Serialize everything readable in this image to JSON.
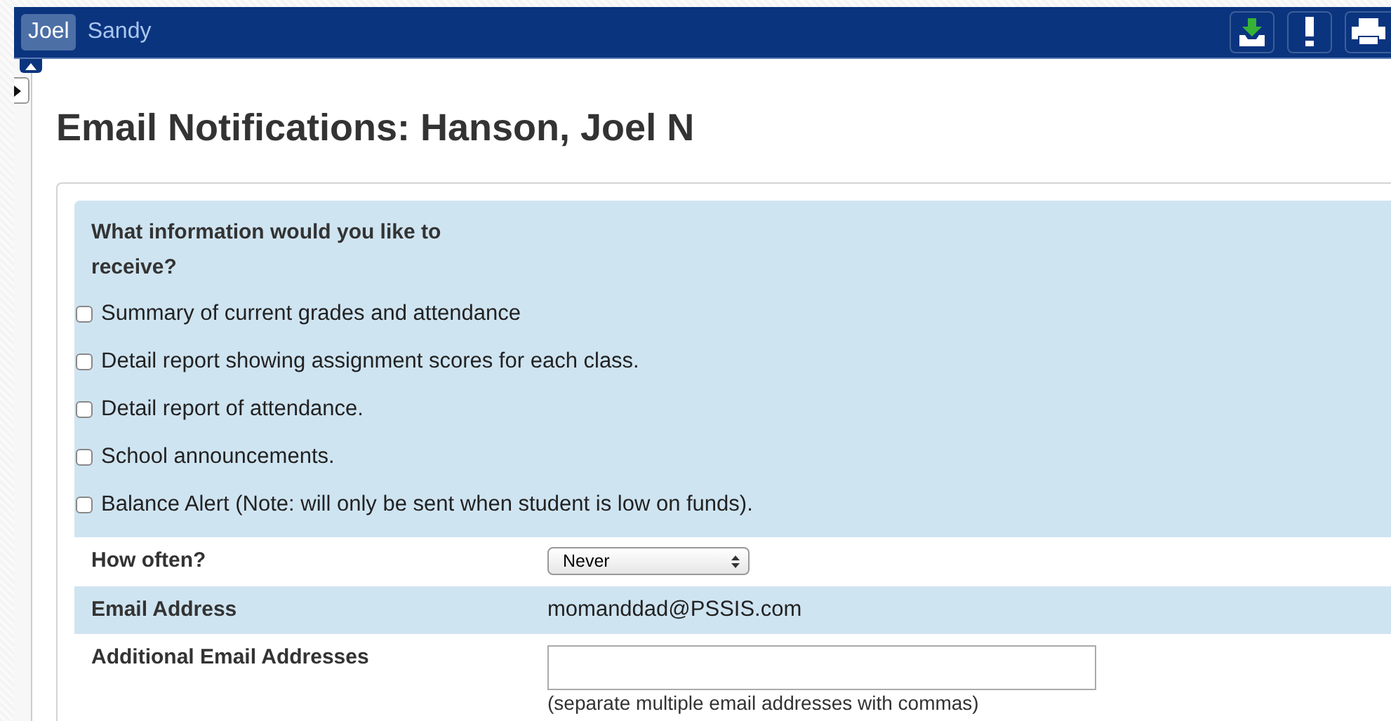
{
  "student_tabs": [
    {
      "label": "Joel",
      "selected": true
    },
    {
      "label": "Sandy",
      "selected": false
    }
  ],
  "heading": "Email Notifications: Hanson, Joel N",
  "question": "What information would you like to receive?",
  "options": [
    {
      "label": "Summary of current grades and attendance",
      "checked": false
    },
    {
      "label": "Detail report showing assignment scores for each class.",
      "checked": false
    },
    {
      "label": "Detail report of attendance.",
      "checked": false
    },
    {
      "label": "School announcements.",
      "checked": false
    },
    {
      "label": "Balance Alert (Note: will only be sent when student is low on funds).",
      "checked": false
    }
  ],
  "rows": [
    {
      "kind": "select",
      "label": "How often?",
      "value": "Never"
    },
    {
      "kind": "text",
      "label": "Email Address",
      "value": "momanddad@PSSIS.com"
    },
    {
      "kind": "input",
      "label": "Additional Email Addresses",
      "value": "",
      "hint": "(separate multiple email addresses with commas)"
    }
  ]
}
